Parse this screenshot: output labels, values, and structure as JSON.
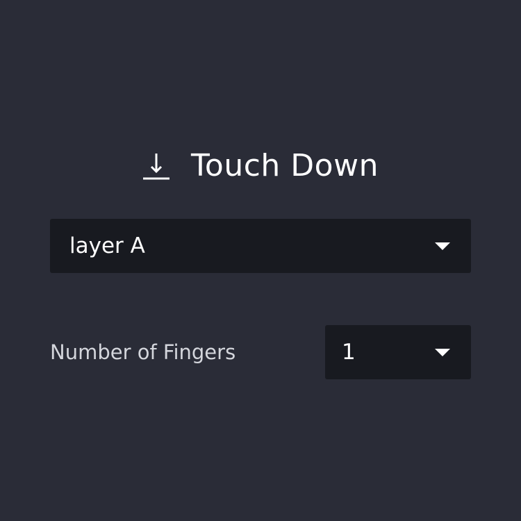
{
  "header": {
    "icon": "download-arrow-icon",
    "title": "Touch Down"
  },
  "layer_select": {
    "value": "layer A",
    "icon": "caret-down-icon"
  },
  "fingers": {
    "label": "Number of Fingers",
    "value": "1",
    "icon": "caret-down-icon"
  },
  "colors": {
    "background": "#2a2c37",
    "select_background": "#181a20",
    "text": "#ffffff",
    "label_text": "#d4d6dc"
  }
}
